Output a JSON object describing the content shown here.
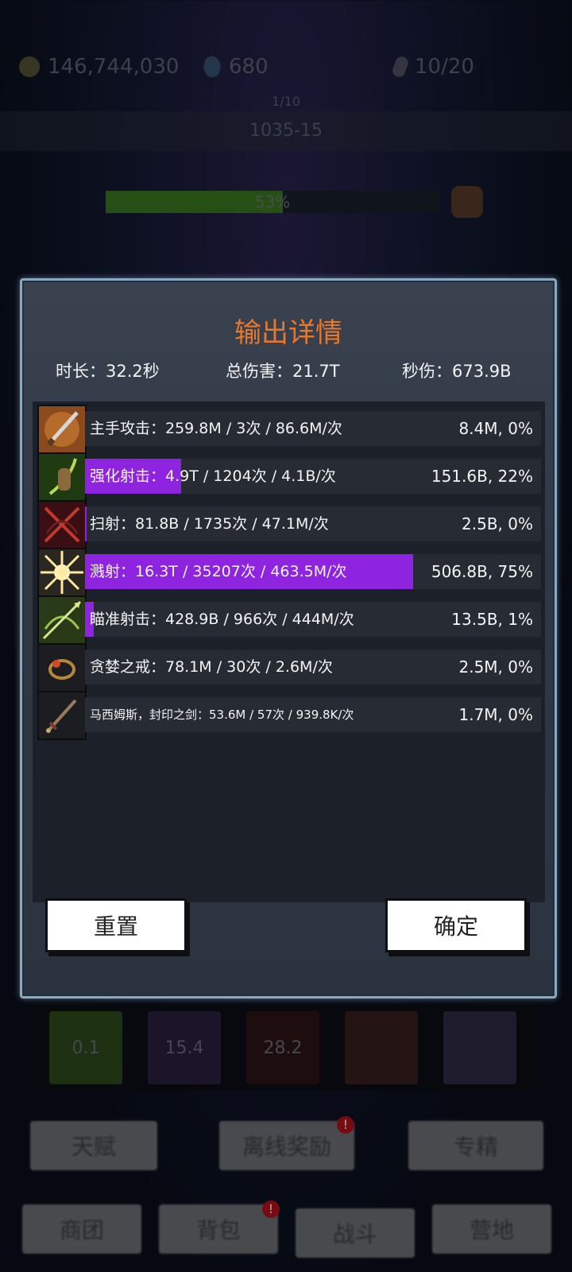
{
  "hud": {
    "gold": "146,744,030",
    "gems": "680",
    "keys": "10/20",
    "stage_label": "1/10",
    "stage_name": "1035-15",
    "boss_hp_text": "53%",
    "boss_hp_fraction": 0.53
  },
  "dialog": {
    "title": "输出详情",
    "duration": "时长：32.2秒",
    "total_damage": "总伤害：21.7T",
    "dps": "秒伤：673.9B",
    "rows": [
      {
        "text": "主手攻击：259.8M  /  3次  /  86.6M/次",
        "value": "8.4M, 0%",
        "share": 0.0,
        "icon": "sword-slash-icon"
      },
      {
        "text": "强化射击：4.9T  /  1204次  /  4.1B/次",
        "value": "151.6B, 22%",
        "share": 0.22,
        "icon": "bow-hand-icon"
      },
      {
        "text": "扫射：81.8B  /  1735次  /  47.1M/次",
        "value": "2.5B, 0%",
        "share": 0.004,
        "icon": "crossed-bow-icon"
      },
      {
        "text": "溅射：16.3T  /  35207次  /  463.5M/次",
        "value": "506.8B, 75%",
        "share": 0.75,
        "icon": "burst-icon"
      },
      {
        "text": "瞄准射击：428.9B  /  966次  /  444M/次",
        "value": "13.5B, 1%",
        "share": 0.02,
        "icon": "aimed-arrow-icon"
      },
      {
        "text": "贪婪之戒：78.1M  /  30次  /  2.6M/次",
        "value": "2.5M, 0%",
        "share": 0.0,
        "icon": "ring-icon"
      },
      {
        "text": "马西姆斯，封印之剑：53.6M  /  57次  /  939.8K/次",
        "value": "1.7M, 0%",
        "share": 0.0,
        "icon": "sealed-sword-icon"
      }
    ],
    "reset_label": "重置",
    "confirm_label": "确定"
  },
  "background": {
    "slots": [
      "0.1",
      "15.4",
      "28.2",
      "",
      ""
    ],
    "row1": [
      "天赋",
      "离线奖励",
      "专精"
    ],
    "row2": [
      "商团",
      "背包",
      "战斗",
      "营地"
    ],
    "badge": "!"
  },
  "colors": {
    "title": "#e8782c",
    "bar": "#8f24e0",
    "boss_hp": "#3b7a22"
  }
}
